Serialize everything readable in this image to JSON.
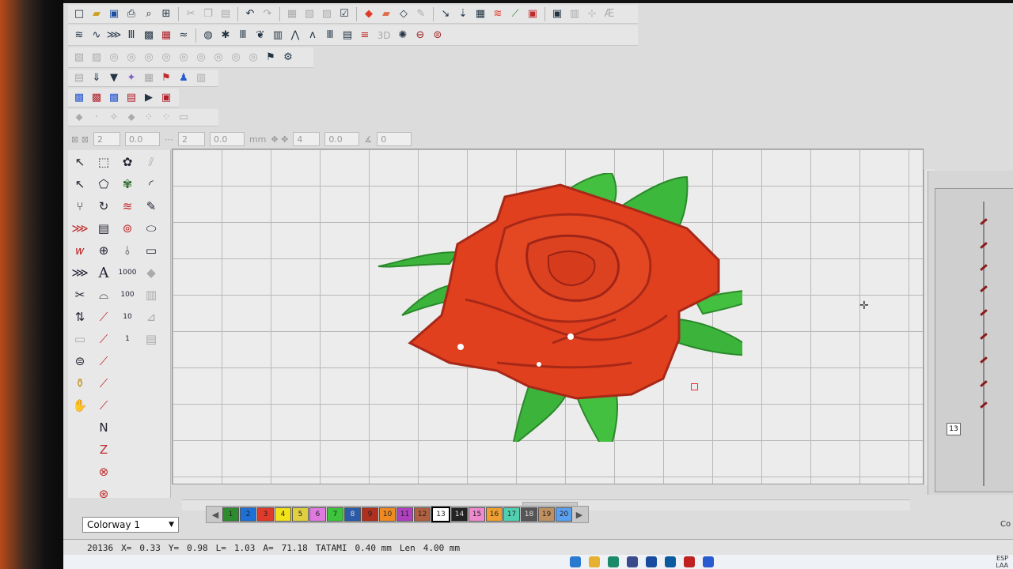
{
  "toolbar": {
    "row1": [
      "new-icon",
      "open-icon",
      "save-icon",
      "print-icon",
      "print-preview-icon",
      "export-icon",
      "cut-icon",
      "copy-icon",
      "paste-icon",
      "undo-icon",
      "redo-icon",
      "group-icon",
      "ungroup-icon",
      "lock-icon",
      "checkbox-icon",
      "satin-icon",
      "fill-icon",
      "outline-icon",
      "color-icon",
      "needle-icon",
      "sequence-icon",
      "grid-icon",
      "stitch-icon",
      "chart-icon",
      "report-icon",
      "design-icon",
      "tile-icon",
      "align-icon",
      "text-ae-icon"
    ],
    "row2_label": "3D"
  },
  "fields": {
    "f1": "2",
    "f2": "0.0",
    "f3": "2",
    "f4": "0.0",
    "f5": "mm",
    "f6": "4",
    "f7": "0.0",
    "f8": "0"
  },
  "left_tools": {
    "text_tool": "A",
    "num_1000a": "1000",
    "num_100": "100",
    "num_10": "10",
    "num_1": "1"
  },
  "colorway": {
    "label": "Colorway 1"
  },
  "palette": {
    "active_index": 13,
    "swatches": [
      {
        "n": "1",
        "c": "#2e8b2e"
      },
      {
        "n": "2",
        "c": "#1e6fd6"
      },
      {
        "n": "3",
        "c": "#e03a2a"
      },
      {
        "n": "4",
        "c": "#f2e21a"
      },
      {
        "n": "5",
        "c": "#e0d040"
      },
      {
        "n": "6",
        "c": "#e07ae0"
      },
      {
        "n": "7",
        "c": "#3cc43c"
      },
      {
        "n": "8",
        "c": "#2a5aa8"
      },
      {
        "n": "9",
        "c": "#b03020"
      },
      {
        "n": "10",
        "c": "#f08a20"
      },
      {
        "n": "11",
        "c": "#b040c0"
      },
      {
        "n": "12",
        "c": "#b06040"
      },
      {
        "n": "13",
        "c": "#ffffff"
      },
      {
        "n": "14",
        "c": "#222222"
      },
      {
        "n": "15",
        "c": "#f08ad0"
      },
      {
        "n": "16",
        "c": "#f0a030"
      },
      {
        "n": "17",
        "c": "#50d0b0"
      },
      {
        "n": "18",
        "c": "#555555"
      },
      {
        "n": "19",
        "c": "#c09060"
      },
      {
        "n": "20",
        "c": "#5aa0f0"
      }
    ]
  },
  "status": {
    "stitches": "20136",
    "x_label": "X=",
    "x_val": "0.33",
    "y_label": "Y=",
    "y_val": "0.98",
    "l_label": "L=",
    "l_val": "1.03",
    "a_label": "A=",
    "a_val": "71.18",
    "stitch_type": "TATAMI",
    "density": "0.40 mm",
    "len_label": "Len",
    "len_val": "4.00 mm"
  },
  "right_panel": {
    "badge": "13",
    "col_label": "Co"
  },
  "taskbar": {
    "lang": "ESP",
    "region": "LAA"
  }
}
